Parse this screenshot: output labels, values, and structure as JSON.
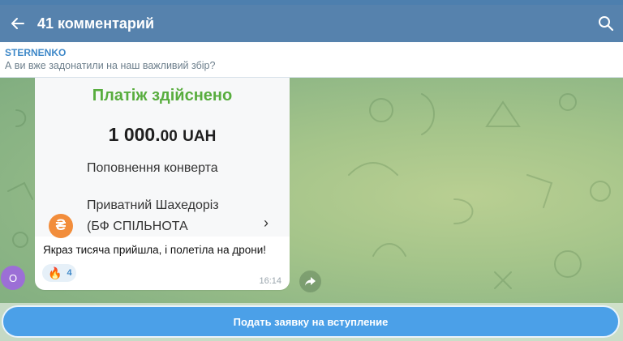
{
  "header": {
    "back_icon": "arrow-left-icon",
    "title": "41 комментарий",
    "search_icon": "search-icon"
  },
  "pinned": {
    "author": "STERNENKO",
    "text": "А ви вже задонатили на наш важливий збір?"
  },
  "message": {
    "receipt": {
      "status": "Платіж здійснено",
      "amount_main": "1 000.",
      "amount_cents": "00",
      "currency": "UAH",
      "description": "Поповнення конверта",
      "recipient_line1": "Приватний Шахедоріз",
      "recipient_line2": "(БФ СПІЛЬНОТА",
      "bank_icon_glyph": "₴",
      "chevron": "›",
      "status_color": "#58ad3e"
    },
    "caption": "Якраз тисяча прийшла, і полетіла на дрони!",
    "reaction": {
      "emoji": "🔥",
      "count": "4"
    },
    "time": "16:14",
    "avatar_letter": "O"
  },
  "footer": {
    "join_label": "Подать заявку на вступление"
  },
  "colors": {
    "appbar": "#5682ad",
    "accent": "#4ba0e8",
    "link": "#3e88c8"
  }
}
